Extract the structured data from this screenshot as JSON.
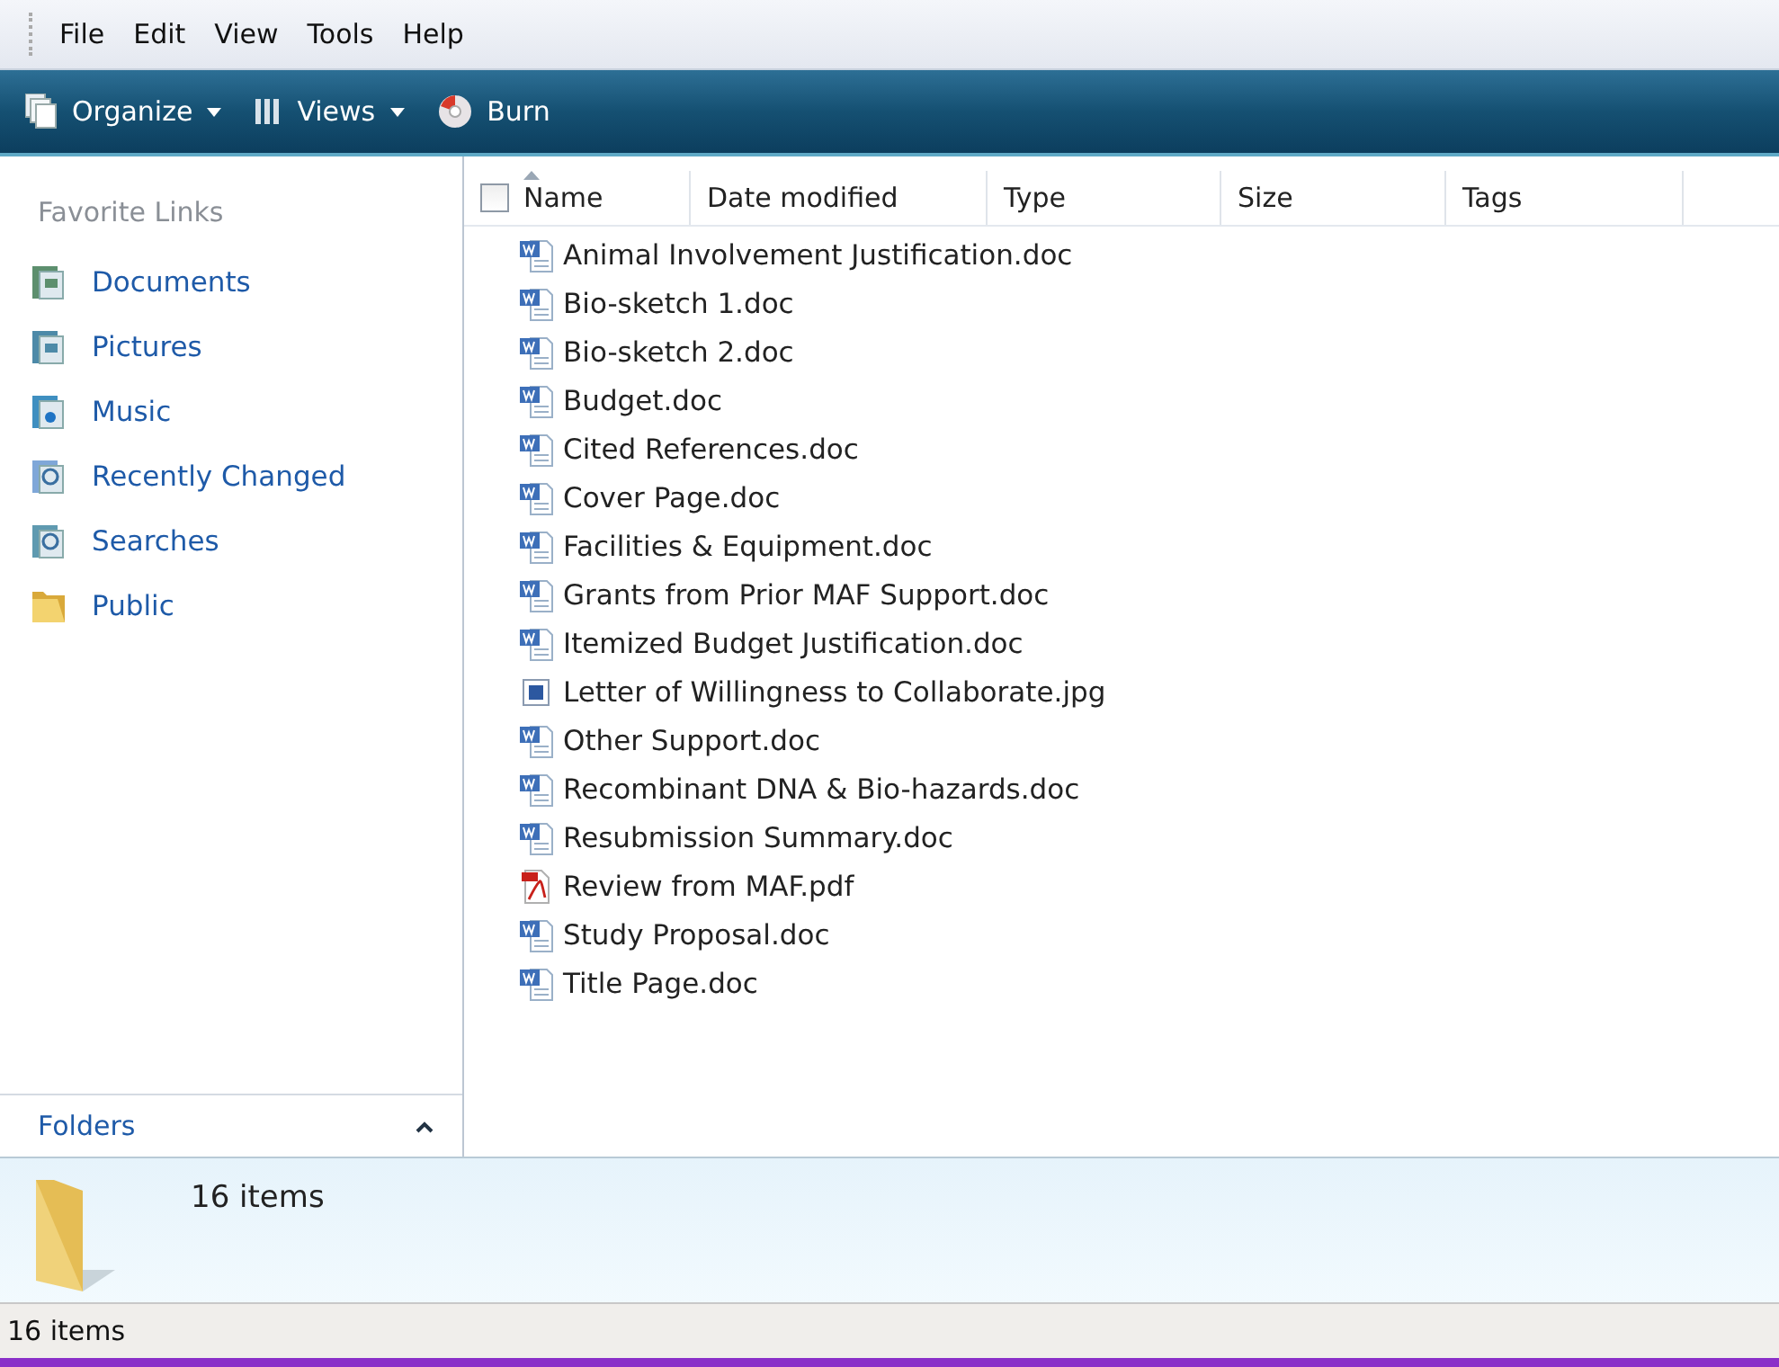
{
  "menu": [
    "File",
    "Edit",
    "View",
    "Tools",
    "Help"
  ],
  "toolbar": [
    {
      "kind": "organize",
      "label": "Organize",
      "dropdown": true
    },
    {
      "kind": "views",
      "label": "Views",
      "dropdown": true
    },
    {
      "kind": "burn",
      "label": "Burn",
      "dropdown": false
    }
  ],
  "sidebar": {
    "heading": "Favorite Links",
    "items": [
      {
        "kind": "documents",
        "label": "Documents"
      },
      {
        "kind": "pictures",
        "label": "Pictures"
      },
      {
        "kind": "music",
        "label": "Music"
      },
      {
        "kind": "recent",
        "label": "Recently Changed"
      },
      {
        "kind": "searches",
        "label": "Searches"
      },
      {
        "kind": "public",
        "label": "Public"
      }
    ],
    "folders": "Folders"
  },
  "table": {
    "select_all": {
      "checked": false
    },
    "columns": [
      "Name",
      "Date modified",
      "Type",
      "Size",
      "Tags"
    ],
    "rows": [
      {
        "kind": "doc",
        "name": "Animal Involvement Justification.doc"
      },
      {
        "kind": "doc",
        "name": "Bio-sketch 1.doc"
      },
      {
        "kind": "doc",
        "name": "Bio-sketch 2.doc"
      },
      {
        "kind": "doc",
        "name": "Budget.doc"
      },
      {
        "kind": "doc",
        "name": "Cited References.doc"
      },
      {
        "kind": "doc",
        "name": "Cover Page.doc"
      },
      {
        "kind": "doc",
        "name": "Facilities & Equipment.doc"
      },
      {
        "kind": "doc",
        "name": "Grants from Prior MAF Support.doc"
      },
      {
        "kind": "doc",
        "name": "Itemized Budget Justification.doc"
      },
      {
        "kind": "jpg",
        "name": "Letter of Willingness to Collaborate.jpg"
      },
      {
        "kind": "doc",
        "name": "Other Support.doc"
      },
      {
        "kind": "doc",
        "name": "Recombinant DNA & Bio-hazards.doc"
      },
      {
        "kind": "doc",
        "name": "Resubmission Summary.doc"
      },
      {
        "kind": "pdf",
        "name": "Review from MAF.pdf"
      },
      {
        "kind": "doc",
        "name": "Study Proposal.doc"
      },
      {
        "kind": "doc",
        "name": "Title Page.doc"
      }
    ]
  },
  "details_pane": {
    "text": "16 items"
  },
  "status_bar": "16 items"
}
